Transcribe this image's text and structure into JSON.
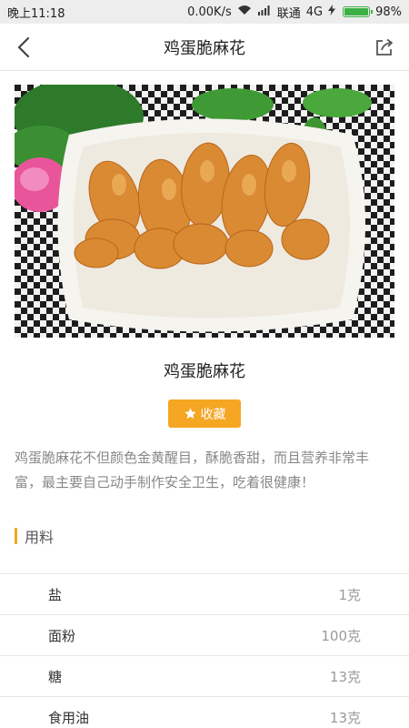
{
  "status_bar": {
    "time": "晚上11:18",
    "network_speed": "0.00K/s",
    "carrier": "联通",
    "network_type": "4G",
    "battery_percent": "98%",
    "battery_level": 0.98
  },
  "nav": {
    "title": "鸡蛋脆麻花",
    "back_icon": "chevron-left-icon",
    "share_icon": "share-icon"
  },
  "recipe": {
    "title": "鸡蛋脆麻花",
    "collect_label": "收藏",
    "description": "鸡蛋脆麻花不但颜色金黄醒目，酥脆香甜，而且营养非常丰富，最主要自己动手制作安全卫生，吃着很健康！"
  },
  "ingredients_section": {
    "title": "用料",
    "items": [
      {
        "name": "盐",
        "amount": "1克"
      },
      {
        "name": "面粉",
        "amount": "100克"
      },
      {
        "name": "糖",
        "amount": "13克"
      },
      {
        "name": "食用油",
        "amount": "13克"
      }
    ]
  },
  "colors": {
    "accent": "#f5a623",
    "status_bar_bg": "#ededed",
    "battery": "#3cb043"
  }
}
